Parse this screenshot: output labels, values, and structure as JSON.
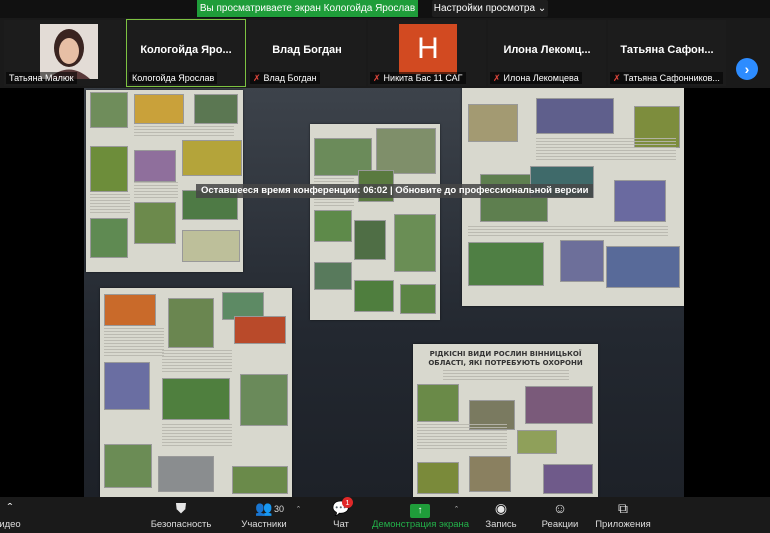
{
  "banner": {
    "sharing_text": "Вы просматриваете экран Кологойда Ярослав",
    "view_options": "Настройки просмотра ⌄"
  },
  "participants": [
    {
      "name": "",
      "label": "Татьяна Малюк",
      "muted": false,
      "kind": "photo"
    },
    {
      "name": "Кологойда  Яро...",
      "label": "Кологойда Ярослав",
      "muted": false,
      "kind": "text",
      "active": true
    },
    {
      "name": "Влад Богдан",
      "label": "Влад Богдан",
      "muted": true,
      "kind": "text"
    },
    {
      "name": "",
      "label": "Никита Бас 11 САГ",
      "muted": true,
      "kind": "avatar",
      "initial": "H",
      "avatar_color": "#d24a21"
    },
    {
      "name": "Илона  Лекомц...",
      "label": "Илона Лекомцева",
      "muted": true,
      "kind": "text"
    },
    {
      "name": "Татьяна  Сафон...",
      "label": "Татьяна Сафонников...",
      "muted": true,
      "kind": "text"
    }
  ],
  "strip_next": "›",
  "timer_text": "Оставшееся время конференции: 06:02 | Обновите до профессиональной версии",
  "poster_title": "РІДКІСНІ ВИДИ РОСЛИН ВІННИЦЬКОЇ ОБЛАСТІ, ЯКІ ПОТРЕБУЮТЬ ОХОРОНИ",
  "toolbar": {
    "video": "идео",
    "security": "Безопасность",
    "participants": "Участники",
    "participants_count": "30",
    "chat": "Чат",
    "chat_badge": "1",
    "share": "Демонстрация экрана",
    "record": "Запись",
    "reactions": "Реакции",
    "apps": "Приложения"
  },
  "colors": {
    "share_green": "#1f9d3a",
    "next_blue": "#2d8cff",
    "badge_red": "#e02828",
    "mute_red": "#e0463c"
  }
}
